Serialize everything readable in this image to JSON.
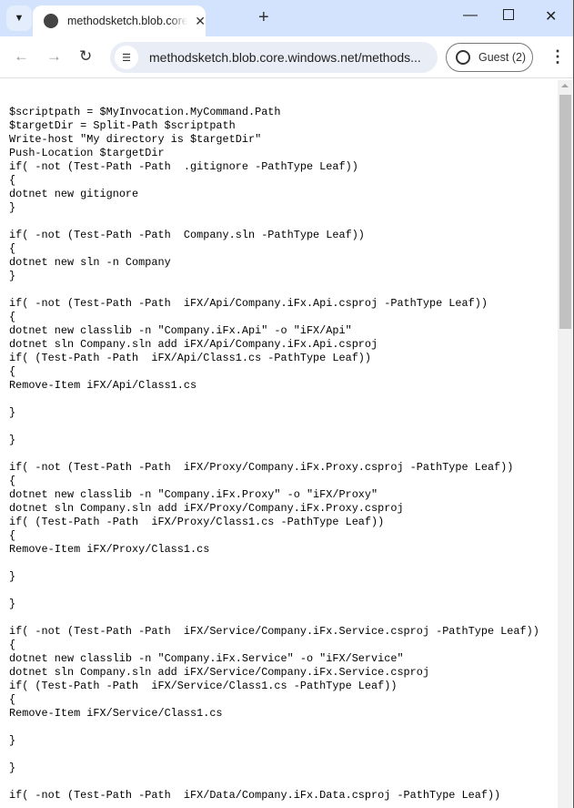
{
  "browser": {
    "tab_title": "methodsketch.blob.core.windows.net",
    "url": "methodsketch.blob.core.windows.net/methods...",
    "profile": "Guest (2)"
  },
  "code": "$scriptpath = $MyInvocation.MyCommand.Path\n$targetDir = Split-Path $scriptpath\nWrite-host \"My directory is $targetDir\"\nPush-Location $targetDir\nif( -not (Test-Path -Path  .gitignore -PathType Leaf))\n{\ndotnet new gitignore\n}\n\nif( -not (Test-Path -Path  Company.sln -PathType Leaf))\n{\ndotnet new sln -n Company\n}\n\nif( -not (Test-Path -Path  iFX/Api/Company.iFx.Api.csproj -PathType Leaf))\n{\ndotnet new classlib -n \"Company.iFx.Api\" -o \"iFX/Api\"\ndotnet sln Company.sln add iFX/Api/Company.iFx.Api.csproj\nif( (Test-Path -Path  iFX/Api/Class1.cs -PathType Leaf))\n{\nRemove-Item iFX/Api/Class1.cs\n\n}\n\n}\n\nif( -not (Test-Path -Path  iFX/Proxy/Company.iFx.Proxy.csproj -PathType Leaf))\n{\ndotnet new classlib -n \"Company.iFx.Proxy\" -o \"iFX/Proxy\"\ndotnet sln Company.sln add iFX/Proxy/Company.iFx.Proxy.csproj\nif( (Test-Path -Path  iFX/Proxy/Class1.cs -PathType Leaf))\n{\nRemove-Item iFX/Proxy/Class1.cs\n\n}\n\n}\n\nif( -not (Test-Path -Path  iFX/Service/Company.iFx.Service.csproj -PathType Leaf))\n{\ndotnet new classlib -n \"Company.iFx.Service\" -o \"iFX/Service\"\ndotnet sln Company.sln add iFX/Service/Company.iFx.Service.csproj\nif( (Test-Path -Path  iFX/Service/Class1.cs -PathType Leaf))\n{\nRemove-Item iFX/Service/Class1.cs\n\n}\n\n}\n\nif( -not (Test-Path -Path  iFX/Data/Company.iFx.Data.csproj -PathType Leaf))"
}
